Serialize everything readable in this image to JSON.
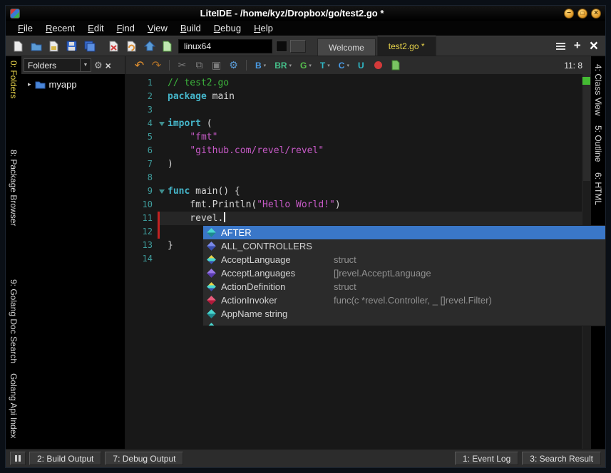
{
  "window": {
    "title": "LiteIDE - /home/kyz/Dropbox/go/test2.go *"
  },
  "menu": {
    "items": [
      "File",
      "Recent",
      "Edit",
      "Find",
      "View",
      "Build",
      "Debug",
      "Help"
    ]
  },
  "toolbar": {
    "file_icons": [
      "new-file",
      "open-folder",
      "open-file",
      "save-file",
      "save-all",
      "close-file",
      "reload-file",
      "home",
      "new-session"
    ],
    "target_combo": "linux64",
    "build_buttons": [
      {
        "label": "B",
        "arrow": true
      },
      {
        "label": "BR",
        "arrow": true
      },
      {
        "label": "G",
        "arrow": true
      },
      {
        "label": "T",
        "arrow": true
      },
      {
        "label": "C",
        "arrow": true
      },
      {
        "label": "U",
        "arrow": false
      }
    ],
    "position_indicator": "11: 8"
  },
  "doc_tabs": [
    {
      "label": "Welcome",
      "active": false
    },
    {
      "label": "test2.go *",
      "active": true
    }
  ],
  "left_tabs": [
    {
      "label": "0: Folders",
      "active": true
    },
    {
      "label": "8: Package Browser",
      "active": false
    },
    {
      "label": "9: Golang Doc Search",
      "active": false
    },
    {
      "label": "Golang Api Index",
      "active": false
    }
  ],
  "right_tabs": [
    {
      "label": "4: Class View"
    },
    {
      "label": "5: Outline"
    },
    {
      "label": "6: HTML"
    }
  ],
  "folders_panel": {
    "combo_label": "Folders",
    "tree": [
      {
        "label": "myapp"
      }
    ]
  },
  "editor": {
    "lines": [
      {
        "num": "1",
        "tokens": [
          {
            "t": "// test2.go",
            "c": "cmt"
          }
        ]
      },
      {
        "num": "2",
        "tokens": [
          {
            "t": "package",
            "c": "kw"
          },
          {
            "t": " main",
            "c": "pln"
          }
        ]
      },
      {
        "num": "3",
        "tokens": []
      },
      {
        "num": "4",
        "fold": true,
        "tokens": [
          {
            "t": "import",
            "c": "kw"
          },
          {
            "t": " (",
            "c": "pln"
          }
        ]
      },
      {
        "num": "5",
        "tokens": [
          {
            "t": "    ",
            "c": "pln"
          },
          {
            "t": "\"fmt\"",
            "c": "str"
          }
        ]
      },
      {
        "num": "6",
        "tokens": [
          {
            "t": "    ",
            "c": "pln"
          },
          {
            "t": "\"github.com/revel/revel\"",
            "c": "str"
          }
        ]
      },
      {
        "num": "7",
        "tokens": [
          {
            "t": ")",
            "c": "pln"
          }
        ]
      },
      {
        "num": "8",
        "tokens": []
      },
      {
        "num": "9",
        "fold": true,
        "tokens": [
          {
            "t": "func",
            "c": "kw"
          },
          {
            "t": " main() {",
            "c": "pln"
          }
        ]
      },
      {
        "num": "10",
        "tokens": [
          {
            "t": "    fmt.Println(",
            "c": "pln"
          },
          {
            "t": "\"Hello World!\"",
            "c": "str"
          },
          {
            "t": ")",
            "c": "pln"
          }
        ]
      },
      {
        "num": "11",
        "current": true,
        "modified": true,
        "cursor": true,
        "tokens": [
          {
            "t": "    revel.",
            "c": "pln"
          }
        ]
      },
      {
        "num": "12",
        "modified": true,
        "tokens": []
      },
      {
        "num": "13",
        "tokens": [
          {
            "t": "}",
            "c": "pln"
          }
        ]
      },
      {
        "num": "14",
        "tokens": []
      }
    ]
  },
  "completion": {
    "items": [
      {
        "name": "AFTER",
        "detail": "",
        "icon": "teal",
        "selected": true
      },
      {
        "name": "ALL_CONTROLLERS",
        "detail": "",
        "icon": "blue",
        "selected": false
      },
      {
        "name": "AcceptLanguage",
        "detail": "struct",
        "icon": "struct",
        "selected": false
      },
      {
        "name": "AcceptLanguages",
        "detail": "[]revel.AcceptLanguage",
        "icon": "purple",
        "selected": false
      },
      {
        "name": "ActionDefinition",
        "detail": "struct",
        "icon": "struct",
        "selected": false
      },
      {
        "name": "ActionInvoker",
        "detail": "func(c *revel.Controller, _ []revel.Filter)",
        "icon": "red",
        "selected": false
      },
      {
        "name": "AppName string",
        "detail": "",
        "icon": "teal",
        "selected": false
      },
      {
        "name": "",
        "detail": "",
        "icon": "teal",
        "selected": false
      }
    ]
  },
  "status_bar": {
    "left": [
      "2: Build Output",
      "7: Debug Output"
    ],
    "right": [
      "1: Event Log",
      "3: Search Result"
    ]
  },
  "colors": {
    "active_tab_text": "#e8d44a",
    "selection_blue": "#3a77c8",
    "comment_green": "#3cb43c",
    "keyword_cyan": "#45b5c9",
    "string_magenta": "#c75ac7",
    "line_number_teal": "#3f9d9d",
    "modified_marker_red": "#c32222",
    "ok_marker_green": "#44bb33"
  }
}
